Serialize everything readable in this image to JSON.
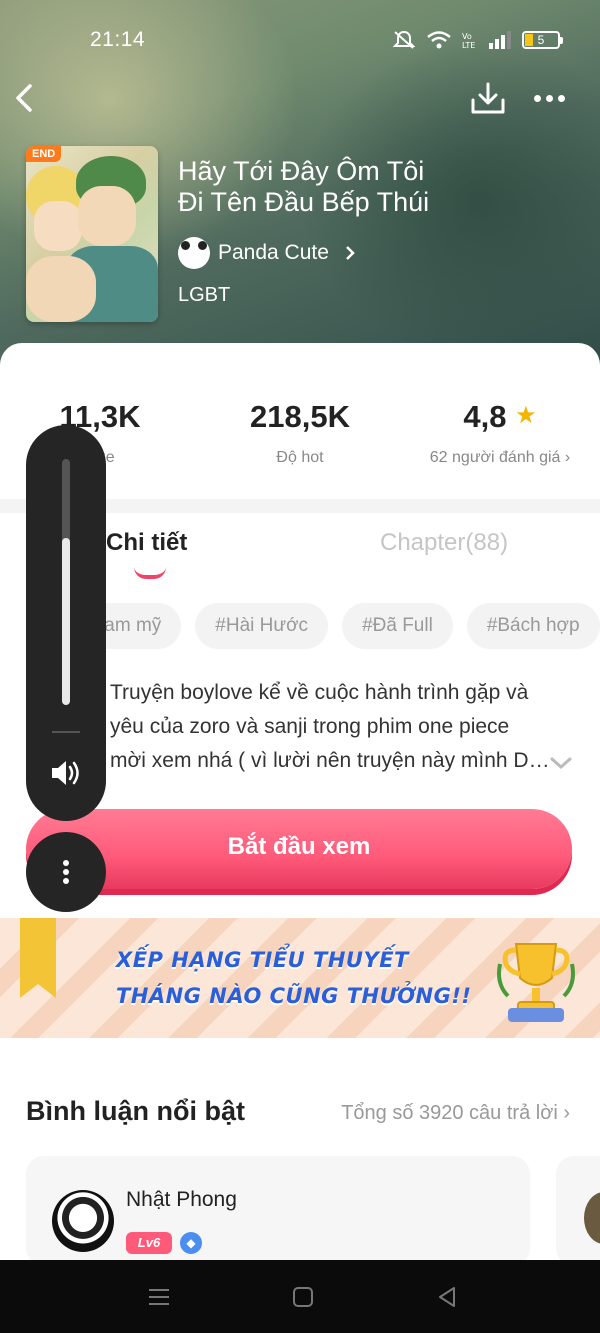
{
  "status_bar": {
    "time": "21:14",
    "battery_level": "5"
  },
  "book": {
    "title_line1": "Hãy Tới Đây Ôm Tôi",
    "title_line2": "Đi Tên Đầu Bếp Thúi",
    "status_badge": "END",
    "author": "Panda Cute",
    "genre": "LGBT"
  },
  "stats": [
    {
      "value": "11,3K",
      "label": "Like"
    },
    {
      "value": "218,5K",
      "label": "Độ hot"
    },
    {
      "value": "4,8",
      "label": "62 người đánh giá"
    }
  ],
  "tabs": [
    {
      "label": "Chi tiết",
      "active": true
    },
    {
      "label": "Chapter(88)",
      "active": false
    }
  ],
  "tags": [
    "#Đam mỹ",
    "#Hài Hước",
    "#Đã Full",
    "#Bách hợp"
  ],
  "description": {
    "line1": "Truyện boylove kể về cuộc hành trình gặp và",
    "line2": "yêu của zoro và sanji trong phim one piece",
    "line3": "mời xem nhá ( vì lười nên truyện này mình Dr..."
  },
  "start_button": {
    "label": "Bắt đầu xem"
  },
  "banner": {
    "line1": "XẾP HẠNG TIỂU THUYẾT",
    "line2": "THÁNG NÀO CŨNG THƯỞNG!!"
  },
  "comments": {
    "heading": "Bình luận nổi bật",
    "total": "Tổng số 3920 câu trả lời",
    "first": {
      "name": "Nhật Phong",
      "level": "Lv6"
    }
  },
  "volume": {
    "level": 0.68
  },
  "colors": {
    "accent": "#ff5a7a",
    "banner_text": "#2b5fd9",
    "star": "#f5b400"
  }
}
